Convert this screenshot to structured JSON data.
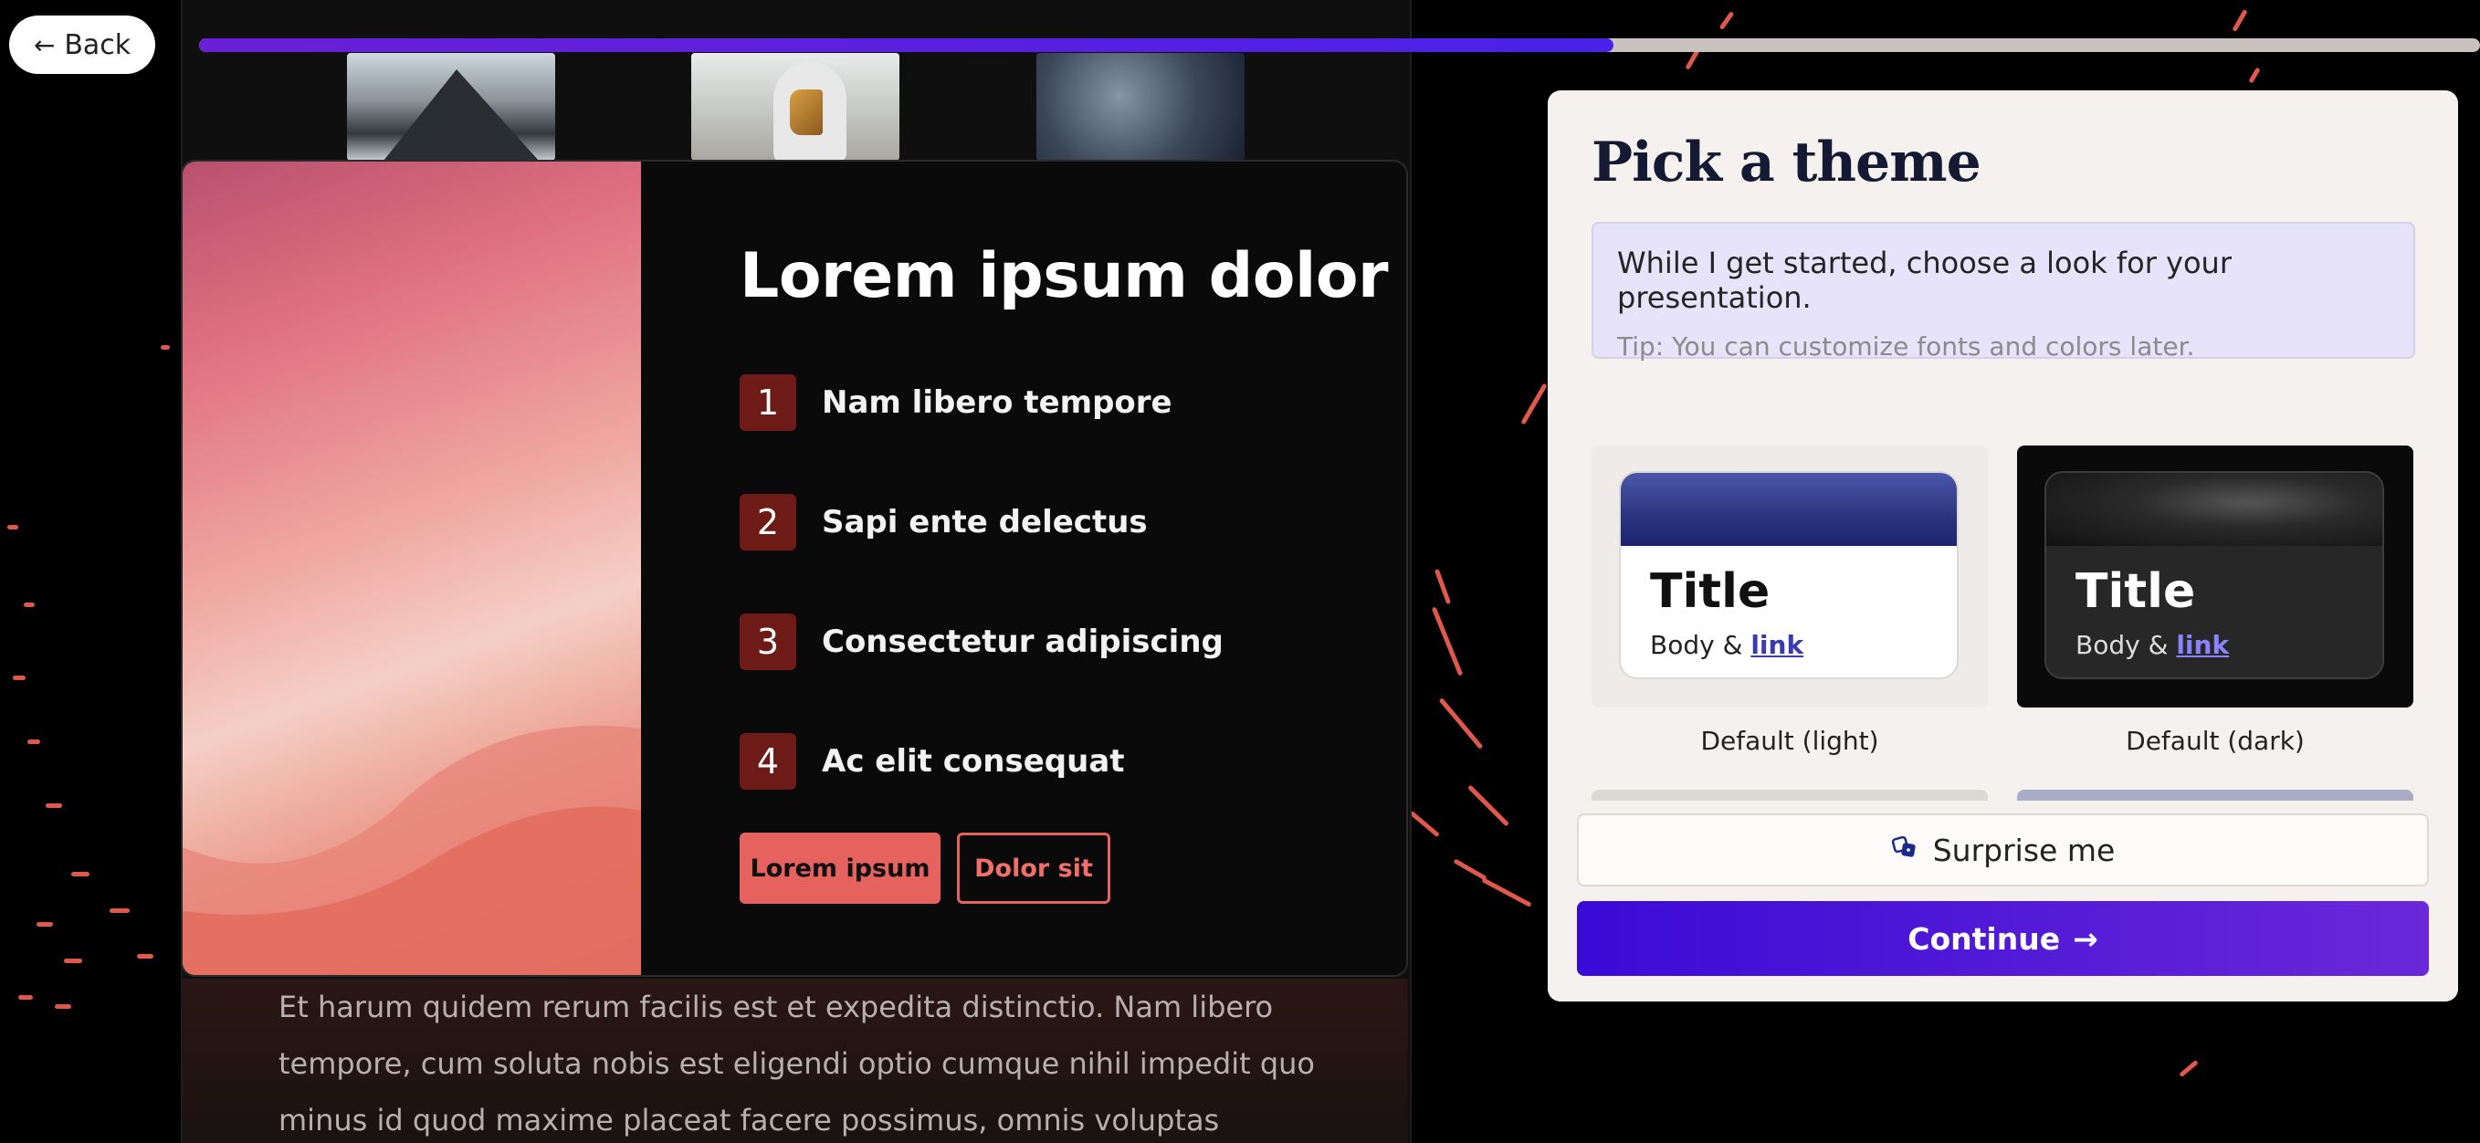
{
  "nav": {
    "back_label": "Back",
    "back_icon": "arrow-left-icon"
  },
  "progress": {
    "fraction": 0.62
  },
  "slide": {
    "title": "Lorem ipsum dolor",
    "items": [
      {
        "num": "1",
        "label": "Nam libero tempore"
      },
      {
        "num": "2",
        "label": "Sapi ente delectus"
      },
      {
        "num": "3",
        "label": "Consectetur adipiscing"
      },
      {
        "num": "4",
        "label": "Ac elit consequat"
      }
    ],
    "primary_button": "Lorem ipsum",
    "secondary_button": "Dolor sit",
    "body_text": "Et harum quidem rerum facilis est et expedita distinctio. Nam libero tempore, cum soluta nobis est eligendi optio cumque nihil impedit quo minus id quod maxime placeat facere possimus, omnis voluptas"
  },
  "picker": {
    "title": "Pick a theme",
    "note_main": "While I get started, choose a look for your presentation.",
    "note_tip": "Tip: You can customize fonts and colors later.",
    "themes": [
      {
        "title": "Title",
        "body": "Body & ",
        "link": "link",
        "caption": "Default (light)"
      },
      {
        "title": "Title",
        "body": "Body & ",
        "link": "link",
        "caption": "Default (dark)"
      }
    ],
    "surprise_label": "Surprise me",
    "continue_label": "Continue"
  }
}
